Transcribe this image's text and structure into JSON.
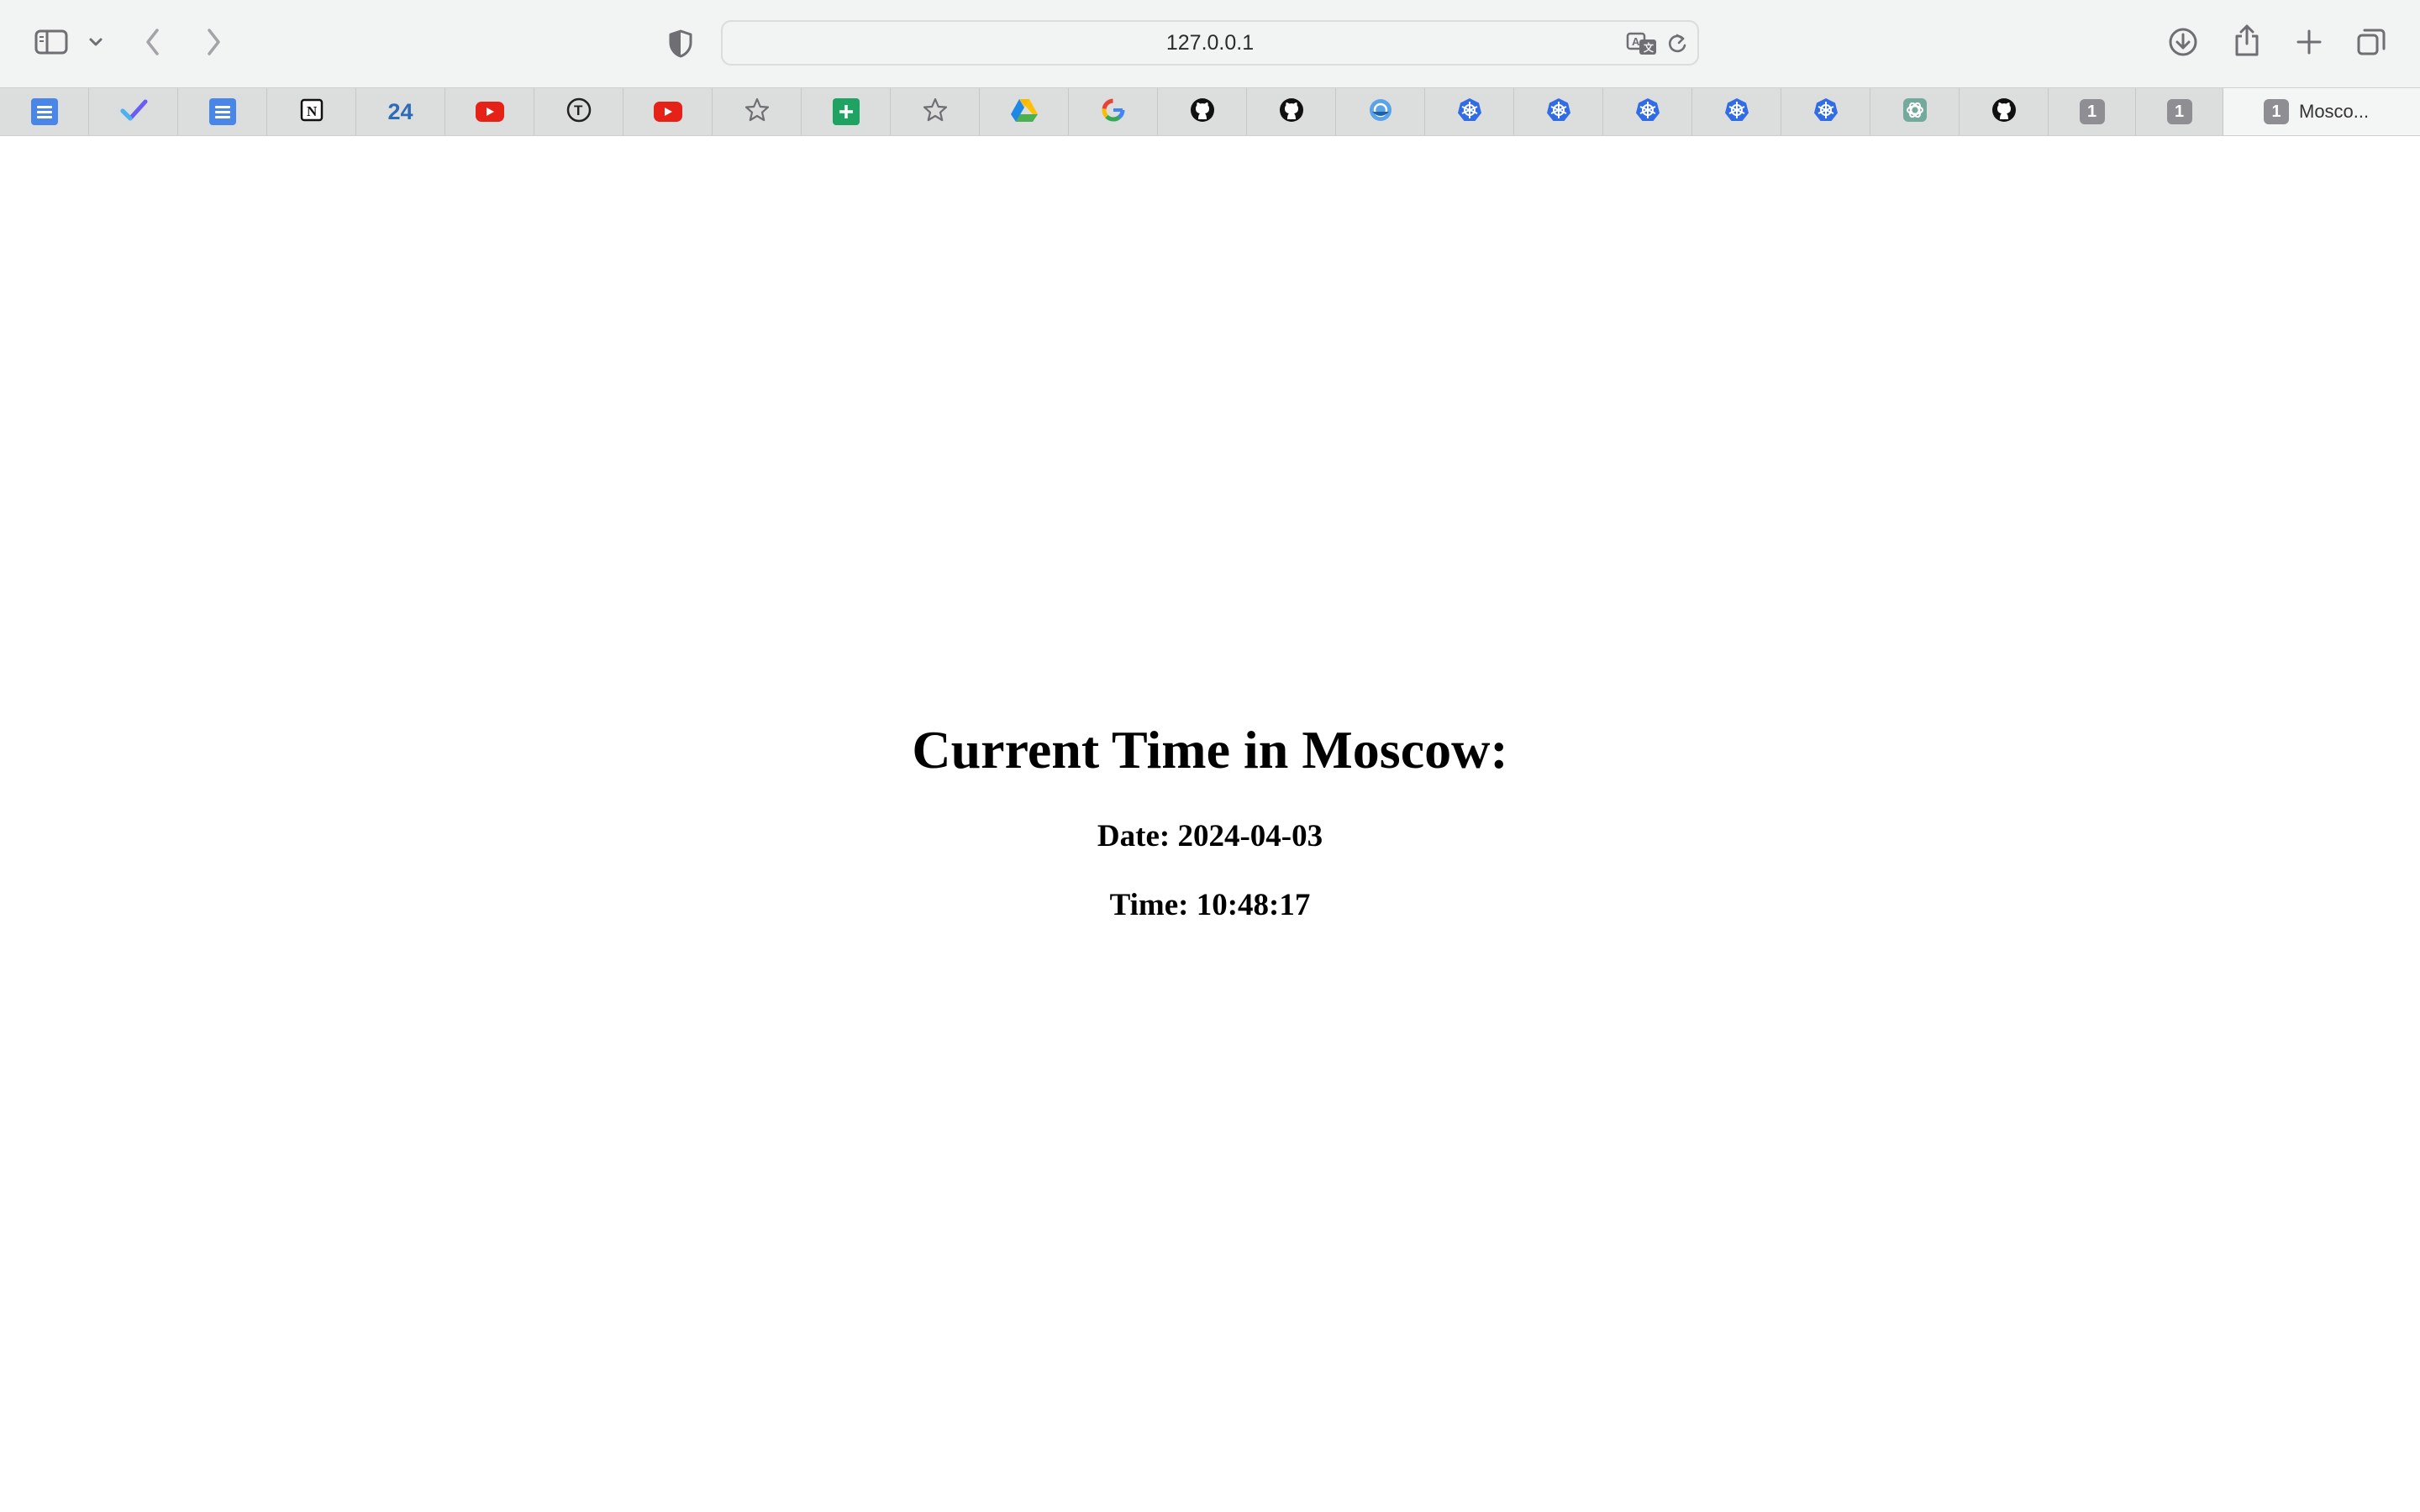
{
  "browser": {
    "url": "127.0.0.1",
    "toolbar_icons": {
      "sidebar": "sidebar-icon",
      "sidebar_menu": "chevron-down-icon",
      "back": "chevron-left-icon",
      "forward": "chevron-right-icon",
      "privacy": "shield-icon",
      "translate": "translate-icon",
      "reload": "reload-icon",
      "downloads": "download-icon",
      "share": "share-icon",
      "new_tab": "plus-icon",
      "tab_overview": "tabs-overview-icon"
    }
  },
  "tabs": [
    {
      "icon": "google-docs-icon"
    },
    {
      "icon": "checkmark-app-icon"
    },
    {
      "icon": "google-docs-icon"
    },
    {
      "icon": "notion-icon",
      "glyph": "N"
    },
    {
      "icon": "24-icon",
      "glyph": "24"
    },
    {
      "icon": "youtube-icon"
    },
    {
      "icon": "t-circle-icon",
      "glyph": "T"
    },
    {
      "icon": "youtube-icon"
    },
    {
      "icon": "star-icon"
    },
    {
      "icon": "google-sheets-icon"
    },
    {
      "icon": "star-icon"
    },
    {
      "icon": "google-drive-icon"
    },
    {
      "icon": "google-icon",
      "glyph": "G"
    },
    {
      "icon": "github-icon"
    },
    {
      "icon": "github-icon"
    },
    {
      "icon": "helm-icon"
    },
    {
      "icon": "kubernetes-icon"
    },
    {
      "icon": "kubernetes-icon"
    },
    {
      "icon": "kubernetes-icon"
    },
    {
      "icon": "kubernetes-icon"
    },
    {
      "icon": "kubernetes-icon"
    },
    {
      "icon": "chatgpt-icon"
    },
    {
      "icon": "github-icon"
    },
    {
      "icon": "number-one-icon",
      "glyph": "1"
    },
    {
      "icon": "number-one-icon",
      "glyph": "1"
    }
  ],
  "active_tab": {
    "icon": "number-one-icon",
    "glyph": "1",
    "title": "Mosco..."
  },
  "page": {
    "heading": "Current Time in Moscow:",
    "date": "Date: 2024-04-03",
    "time": "Time: 10:48:17"
  }
}
